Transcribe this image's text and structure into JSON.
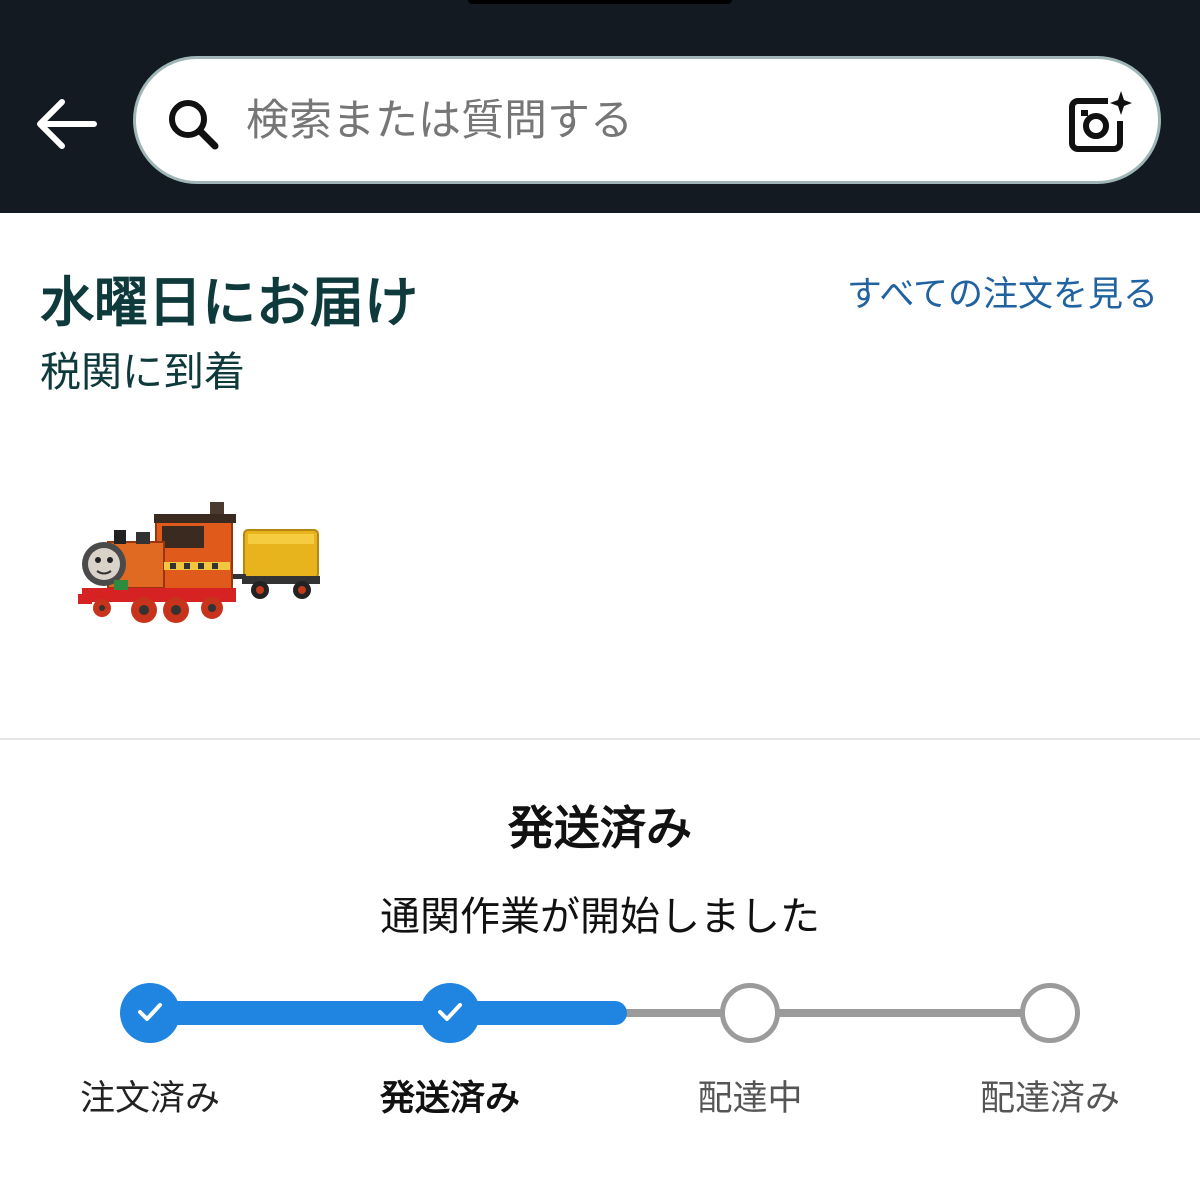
{
  "header": {
    "search": {
      "placeholder": "検索または質問する",
      "value": ""
    },
    "icons": [
      "back-arrow-icon",
      "search-icon",
      "camera-sparkle-icon"
    ]
  },
  "delivery": {
    "headline": "水曜日にお届け",
    "subline": "税関に到着",
    "all_orders_link": "すべての注文を見る"
  },
  "product": {
    "image_alt": "toy-train"
  },
  "status": {
    "title": "発送済み",
    "description": "通関作業が開始しました"
  },
  "tracker": {
    "progress": 0.53,
    "steps": [
      {
        "label": "注文済み",
        "state": "complete"
      },
      {
        "label": "発送済み",
        "state": "complete"
      },
      {
        "label": "配達中",
        "state": "pending"
      },
      {
        "label": "配達済み",
        "state": "pending"
      }
    ]
  },
  "colors": {
    "header_bg": "#131a22",
    "link": "#2162a1",
    "headline": "#0f3a3c",
    "progress_active": "#1f85e0",
    "progress_inactive": "#9b9b9b"
  }
}
